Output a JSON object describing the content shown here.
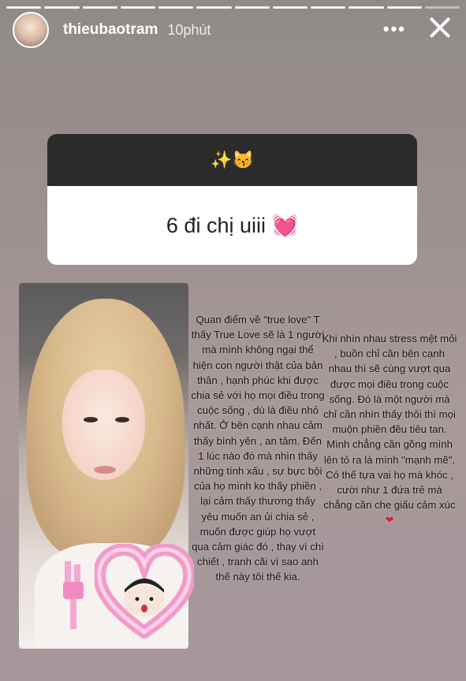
{
  "story": {
    "username": "thieubaotram",
    "time": "10phút",
    "progress_segments": 12
  },
  "question_box": {
    "prompt": "✨😽",
    "answer": "6 đi chị uiii 💓"
  },
  "text_left": "Quan điểm về \"true love\" T thấy True Love sẽ là 1 người mà mình không ngại thể hiện con người thật của bản thân , hạnh phúc khi được chia sẻ với họ mọi điều trong cuộc sống , dù là điều nhỏ nhất. Ở bên cạnh nhau cảm thấy bình yên , an tâm. Đến 1 lúc nào đó mà nhìn thấy những tính xấu , sự bực bội của họ mình ko thấy phiền , lại cảm thấy thương thấy yêu muốn an ủi chia sẻ , muốn được giúp họ vượt qua cảm giác đó , thay vì chì chiết , tranh cãi vì sao anh thế này tôi thế kia.",
  "text_right": "Khi nhìn nhau stress mệt mỏi , buồn chỉ cần bên cạnh nhau thì sẽ cùng vượt qua được mọi điều trong cuộc sống. Đó là một người mà chỉ cần nhìn thấy thôi thì mọi muộn phiền đều tiêu tan. Mình chẳng cần gồng mình lên tỏ ra là mình \"mạnh mẽ\". Có thể tựa vai họ mà khóc , cười như 1 đứa trẻ mà chẳng cần che giấu cảm xúc",
  "text_right_end": "❤",
  "icons": {
    "more": "more-dots-icon",
    "close": "close-icon"
  },
  "colors": {
    "question_header": "#2b2b2b",
    "sticker_pink": "#f08cc4"
  }
}
